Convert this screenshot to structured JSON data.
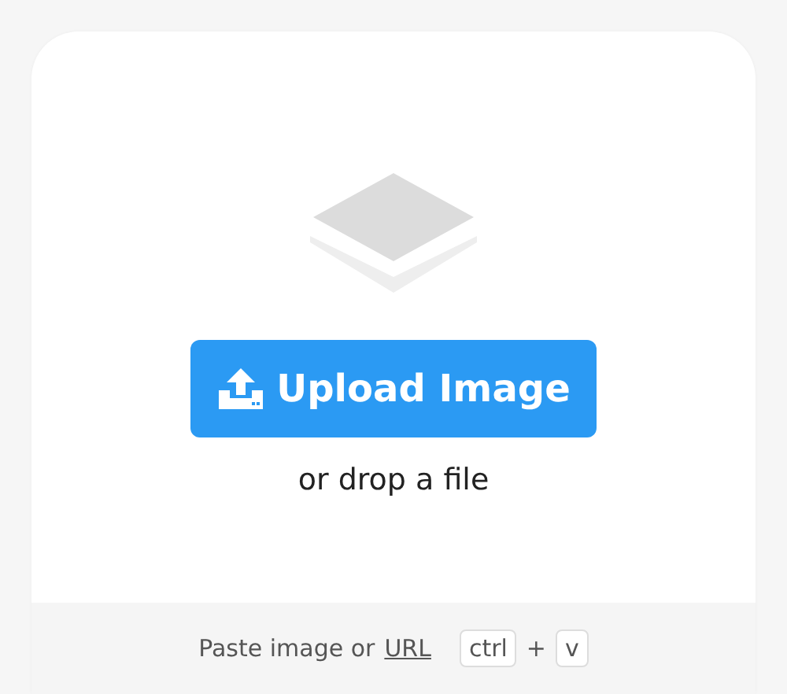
{
  "upload_button": {
    "label": "Upload Image"
  },
  "drop_hint": "or drop a file",
  "paste_bar": {
    "text": "Paste image or",
    "link": "URL",
    "keys": [
      "ctrl",
      "v"
    ],
    "separator": "+"
  }
}
